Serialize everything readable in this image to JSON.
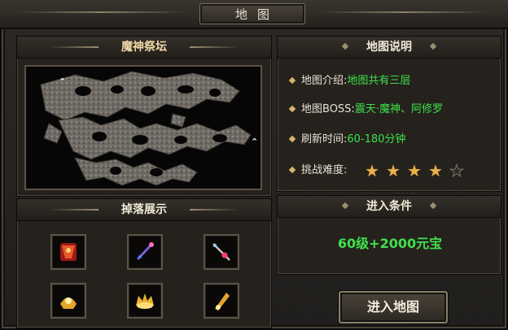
{
  "window": {
    "title": "地图"
  },
  "left": {
    "map_name": "魔神祭坛",
    "drops_title": "掉落展示",
    "drops": [
      {
        "icon": "red-armor-icon"
      },
      {
        "icon": "purple-staff-icon"
      },
      {
        "icon": "red-spear-icon"
      },
      {
        "icon": "gold-helmet-icon"
      },
      {
        "icon": "gold-crown-icon"
      },
      {
        "icon": "gold-blade-icon"
      }
    ]
  },
  "right": {
    "info_title": "地图说明",
    "rows": [
      {
        "label": "地图介绍:",
        "value": "地图共有三层"
      },
      {
        "label": "地图BOSS:",
        "value": "震天·魔神、阿修罗"
      },
      {
        "label": "刷新时间:",
        "value": "60-180分钟"
      },
      {
        "label": "挑战难度:",
        "value": ""
      }
    ],
    "difficulty": {
      "filled": 4,
      "total": 5
    },
    "cond_title": "进入条件",
    "cond_text": "60级+2000元宝",
    "enter_button": "进入地图"
  },
  "colors": {
    "accent_green": "#3fe04a",
    "gold": "#e7b24a",
    "text": "#e9e2d2"
  }
}
